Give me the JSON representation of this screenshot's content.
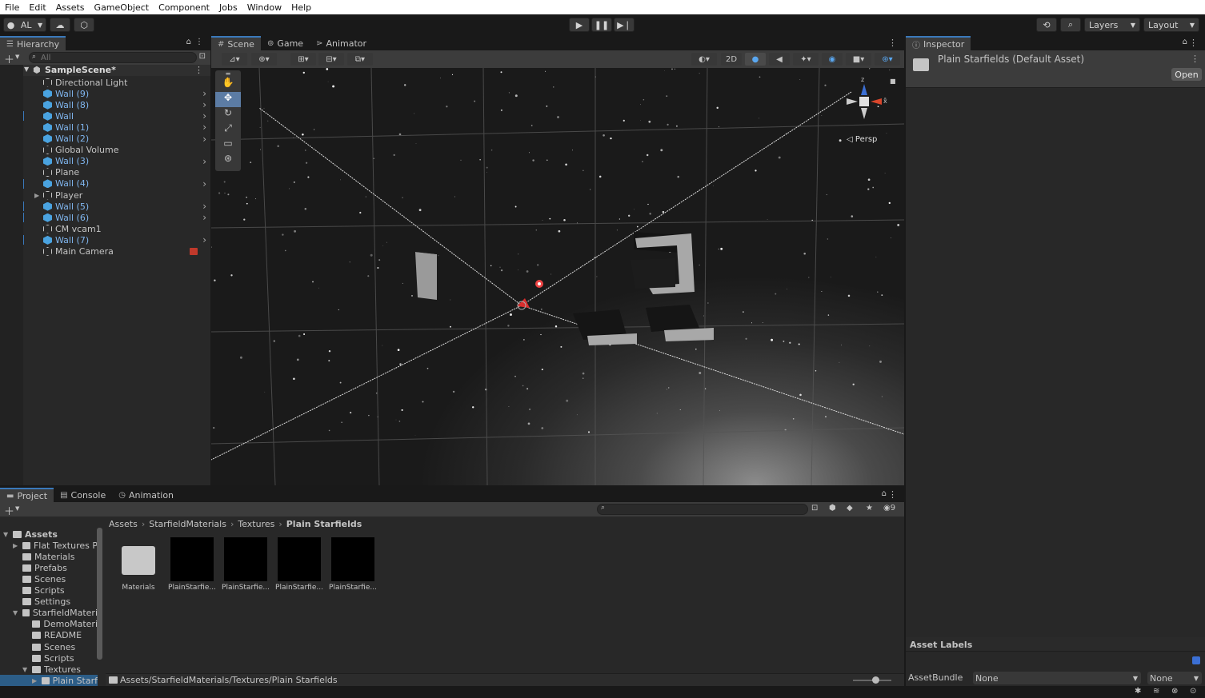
{
  "menu": {
    "file": "File",
    "edit": "Edit",
    "assets": "Assets",
    "gameobject": "GameObject",
    "component": "Component",
    "jobs": "Jobs",
    "window": "Window",
    "help": "Help"
  },
  "toolbar": {
    "account": "AL",
    "layers": "Layers",
    "layout": "Layout"
  },
  "hierarchy": {
    "tab": "Hierarchy",
    "search_placeholder": "All",
    "scene": "SampleScene*",
    "items": [
      {
        "label": "Directional Light",
        "blue": false,
        "chev": false
      },
      {
        "label": "Wall (9)",
        "blue": true,
        "chev": true
      },
      {
        "label": "Wall (8)",
        "blue": true,
        "chev": true
      },
      {
        "label": "Wall",
        "blue": true,
        "chev": true
      },
      {
        "label": "Wall (1)",
        "blue": true,
        "chev": true
      },
      {
        "label": "Wall (2)",
        "blue": true,
        "chev": true
      },
      {
        "label": "Global Volume",
        "blue": false,
        "chev": false
      },
      {
        "label": "Wall (3)",
        "blue": true,
        "chev": true
      },
      {
        "label": "Plane",
        "blue": false,
        "chev": false
      },
      {
        "label": "Wall (4)",
        "blue": true,
        "chev": true
      },
      {
        "label": "Player",
        "blue": false,
        "chev": false
      },
      {
        "label": "Wall (5)",
        "blue": true,
        "chev": true
      },
      {
        "label": "Wall (6)",
        "blue": true,
        "chev": true
      },
      {
        "label": "CM vcam1",
        "blue": false,
        "chev": false
      },
      {
        "label": "Wall (7)",
        "blue": true,
        "chev": true
      },
      {
        "label": "Main Camera",
        "blue": false,
        "chev": false
      }
    ]
  },
  "scene": {
    "tab_scene": "Scene",
    "tab_game": "Game",
    "tab_animator": "Animator",
    "mode_2d": "2D",
    "persp": "Persp",
    "axis_z": "z",
    "axis_x": "x"
  },
  "inspector": {
    "tab": "Inspector",
    "asset_title": "Plain Starfields (Default Asset)",
    "open": "Open",
    "asset_labels": "Asset Labels",
    "assetbundle": "AssetBundle",
    "bundle_value": "None",
    "variant_value": "None"
  },
  "project": {
    "tab_project": "Project",
    "tab_console": "Console",
    "tab_animation": "Animation",
    "hidden_count": "9",
    "breadcrumb": [
      "Assets",
      "StarfieldMaterials",
      "Textures",
      "Plain Starfields"
    ],
    "tree": [
      {
        "label": "Assets",
        "bold": true
      },
      {
        "label": "Flat Textures P",
        "bold": false
      },
      {
        "label": "Materials",
        "bold": false
      },
      {
        "label": "Prefabs",
        "bold": false
      },
      {
        "label": "Scenes",
        "bold": false
      },
      {
        "label": "Scripts",
        "bold": false
      },
      {
        "label": "Settings",
        "bold": false
      },
      {
        "label": "StarfieldMateri",
        "bold": false
      },
      {
        "label": "DemoMateri",
        "bold": false
      },
      {
        "label": "README",
        "bold": false
      },
      {
        "label": "Scenes",
        "bold": false
      },
      {
        "label": "Scripts",
        "bold": false
      },
      {
        "label": "Textures",
        "bold": false
      },
      {
        "label": "Plain Starf",
        "bold": false
      }
    ],
    "grid": [
      {
        "label": "Materials"
      },
      {
        "label": "PlainStarfie..."
      },
      {
        "label": "PlainStarfie..."
      },
      {
        "label": "PlainStarfie..."
      },
      {
        "label": "PlainStarfie..."
      }
    ],
    "path": "Assets/StarfieldMaterials/Textures/Plain Starfields"
  }
}
